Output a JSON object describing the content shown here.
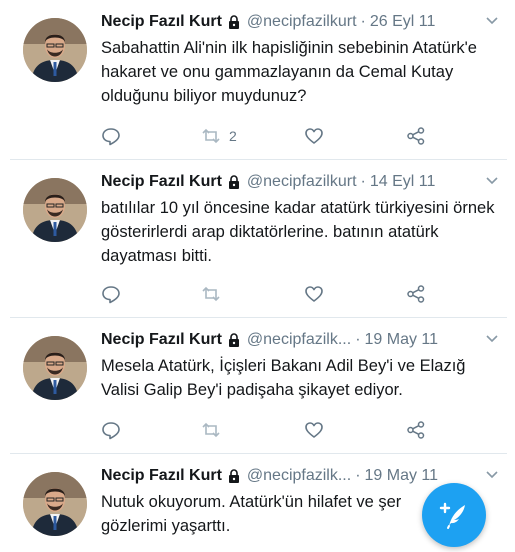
{
  "colors": {
    "accent": "#1da1f2",
    "text": "#14171a",
    "muted": "#657786",
    "icon": "#657786"
  },
  "tweets": [
    {
      "name": "Necip Fazıl Kurt",
      "handle": "@necipfazilkurt",
      "date": "26 Eyl 11",
      "text": "Sabahattin Ali'nin ilk hapisliğinin sebebinin Atatürk'e hakaret ve onu gammazlayanın da Cemal Kutay olduğunu biliyor muydunuz?",
      "retweet_count": "2"
    },
    {
      "name": "Necip Fazıl Kurt",
      "handle": "@necipfazilkurt",
      "date": "14 Eyl 11",
      "text": "batılılar 10 yıl öncesine kadar atatürk türkiyesini örnek gösterirlerdi arap diktatörlerine. batının atatürk dayatması bitti.",
      "retweet_count": ""
    },
    {
      "name": "Necip Fazıl Kurt",
      "handle": "@necipfazilk...",
      "date": "19 May 11",
      "text": "Mesela Atatürk, İçişleri Bakanı Adil Bey'i ve Elazığ Valisi Galip Bey'i padişaha şikayet ediyor.",
      "retweet_count": ""
    },
    {
      "name": "Necip Fazıl Kurt",
      "handle": "@necipfazilk...",
      "date": "19 May 11",
      "text": "Nutuk okuyorum. Atatürk'ün hilafet ve şer gözlerimi yaşarttı.",
      "retweet_count": ""
    }
  ],
  "icons": {
    "reply": "reply-icon",
    "retweet": "retweet-icon",
    "like": "heart-icon",
    "share": "share-icon",
    "lock": "lock-icon",
    "more": "chevron-down-icon",
    "compose": "compose-icon"
  }
}
